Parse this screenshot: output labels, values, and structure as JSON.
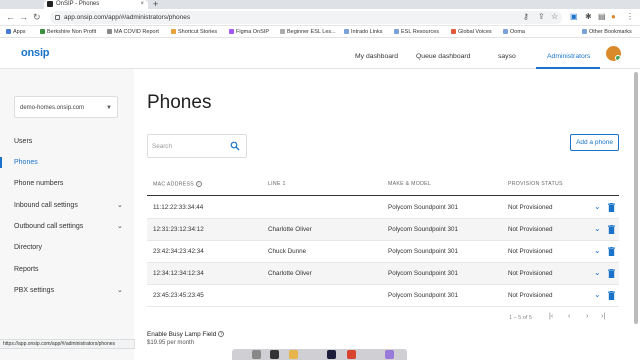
{
  "browser": {
    "tab_title": "OnSIP - Phones",
    "tab_close": "×",
    "new_tab": "+",
    "url": "app.onsip.com/app/#/administrators/phones",
    "bookmarks": [
      "Apps",
      "Berkshire Non Profit",
      "MA COVID Report",
      "Shortcut Stories",
      "Figma OnSIP",
      "Beginner ESL Les...",
      "Intrado Links",
      "ESL Resources",
      "Global Voices",
      "Ooma",
      "Other Bookmarks"
    ],
    "status_url": "https://app.onsip.com/app/#/administrators/phones"
  },
  "header": {
    "logo": "onsip",
    "nav": [
      "My dashboard",
      "Queue dashboard",
      "sayso",
      "Administrators"
    ],
    "active_nav": "Administrators"
  },
  "sidebar": {
    "org": "demo-homes.onsip.com",
    "items": [
      {
        "label": "Users"
      },
      {
        "label": "Phones"
      },
      {
        "label": "Phone numbers"
      },
      {
        "label": "Inbound call settings"
      },
      {
        "label": "Outbound call settings"
      },
      {
        "label": "Directory"
      },
      {
        "label": "Reports"
      },
      {
        "label": "PBX settings"
      }
    ]
  },
  "main": {
    "title": "Phones",
    "search_placeholder": "Search",
    "add_button": "Add a phone",
    "columns": [
      "MAC ADDRESS",
      "LINE 1",
      "MAKE & MODEL",
      "PROVISION STATUS"
    ],
    "rows": [
      {
        "mac": "11:12:22:33:34:44",
        "line1": "",
        "model": "Polycom Soundpoint 301",
        "status": "Not Provisioned"
      },
      {
        "mac": "12:31:23:12:34:12",
        "line1": "Charlotte Oliver",
        "model": "Polycom Soundpoint 301",
        "status": "Not Provisioned"
      },
      {
        "mac": "23:42:34:23:42:34",
        "line1": "Chuck Dunne",
        "model": "Polycom Soundpoint 301",
        "status": "Not Provisioned"
      },
      {
        "mac": "12:34:12:34:12:34",
        "line1": "Charlotte Oliver",
        "model": "Polycom Soundpoint 301",
        "status": "Not Provisioned"
      },
      {
        "mac": "23:45:23:45:23:45",
        "line1": "",
        "model": "Polycom Soundpoint 301",
        "status": "Not Provisioned"
      }
    ],
    "pagination": "1 – 5 of 5",
    "busy_lamp_title": "Enable Busy Lamp Field",
    "busy_lamp_price": "$19.95 per month"
  },
  "colors": {
    "accent": "#1a73c8",
    "danger": "#1a73c8",
    "sidebar_bg": "#f7f7f7"
  }
}
